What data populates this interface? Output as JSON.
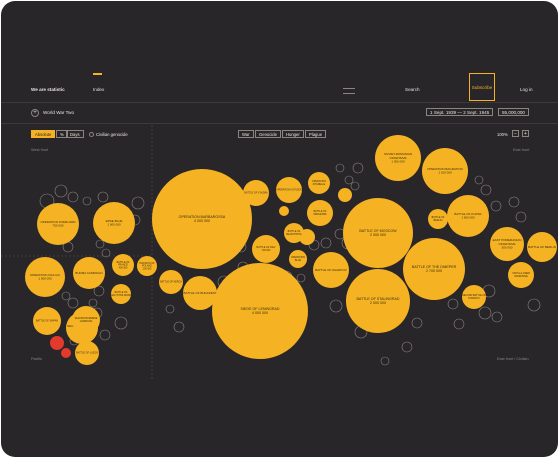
{
  "nav": {
    "brand": "We are statistic",
    "index": "Index",
    "search": "Search",
    "subscribe": "Subscribe",
    "login": "Log in"
  },
  "toolbar": {
    "ww_label": "World War Two",
    "date_range": "1 Sept. 1939 — 2 Sept. 1945",
    "total": "55,000,000"
  },
  "controls": {
    "absolute": "Absolute",
    "percent": "%",
    "days": "Days",
    "civilian": "Civilian genocide",
    "filters": [
      "War",
      "Genocide",
      "Hunger",
      "Plague"
    ],
    "zoom": "100%",
    "zoom_out": "−",
    "zoom_in": "+"
  },
  "regions": {
    "west": "West front",
    "east": "East front",
    "pacific": "Pacific",
    "east_civil": "East front / Civilian"
  },
  "colors": {
    "background": "#29262a",
    "accent": "#f5b323",
    "red": "#e23a2c",
    "muted": "#8a8580"
  },
  "bubbles": [
    {
      "label": "OPERATION BARBAROSSA",
      "value": "4 000 000",
      "color": "#f5b323"
    },
    {
      "label": "SIEGE OF LENINGRAD",
      "value": "4 000 000",
      "color": "#f5b323"
    },
    {
      "label": "BATTLE OF MOSCOW",
      "value": "2 000 000",
      "color": "#f5b323"
    },
    {
      "label": "BATTLE OF STALINGRAD",
      "value": "2 000 000",
      "color": "#f5b323"
    },
    {
      "label": "BATTLE OF THE DNIEPER",
      "value": "2 700 000",
      "color": "#f5b323"
    },
    {
      "label": "SOVIET-ROMANIAN OFFENSIVE",
      "value": "1 300 000",
      "color": "#f5b323"
    },
    {
      "label": "OPERATION BAGRATION",
      "value": "1 100 000",
      "color": "#f5b323"
    },
    {
      "label": "BATTLE OF KURSK",
      "value": "1 600 000",
      "color": "#f5b323"
    },
    {
      "label": "EAST POMERANIAN OFFENSIVE",
      "value": "500 000",
      "color": "#f5b323"
    },
    {
      "label": "BATTLE OF BERLIN",
      "value": "",
      "color": "#f5b323"
    },
    {
      "label": "OPERATION OVERLORD",
      "value": "750 000",
      "color": "#f5b323"
    },
    {
      "label": "ERSE BLUE",
      "value": "1 000 000",
      "color": "#f5b323"
    },
    {
      "label": "BATTLE OF FRANCE",
      "value": "400 000",
      "color": "#f5b323"
    },
    {
      "label": "INVASION OF POLAND",
      "value": "200 000",
      "color": "#f5b323"
    },
    {
      "label": "OPERATION KANTAKURI",
      "value": "",
      "color": "#f5b323"
    },
    {
      "label": "OPERATION ICHI-GO",
      "value": "1 000 000",
      "color": "#f5b323"
    },
    {
      "label": "BATTLE OF SAIPAN",
      "value": "",
      "color": "#f5b323"
    },
    {
      "label": "SECOND BATTLE OF SAIPAN",
      "value": "",
      "color": "#f5b323"
    },
    {
      "label": "SECOND BURMESE CAMPAIGN",
      "value": "",
      "color": "#f5b323"
    },
    {
      "label": "BURMA CAMPAIGN",
      "value": "",
      "color": "#f5b323"
    },
    {
      "label": "BATTLE OF LUZON",
      "value": "",
      "color": "#f5b323"
    },
    {
      "label": "BATTLE OF SMOLENSK",
      "value": "",
      "color": "#f5b323"
    },
    {
      "label": "BATTLE OF KIEV",
      "value": "700 000",
      "color": "#f5b323"
    },
    {
      "label": "BATTLE OF VYAZMA",
      "value": "",
      "color": "#f5b323"
    },
    {
      "label": "BATTLE OF KHARKOV",
      "value": "",
      "color": "#f5b323"
    },
    {
      "label": "BATTLE OF BUDAPEST",
      "value": "",
      "color": "#f5b323"
    },
    {
      "label": "BATTLE OF KERCH",
      "value": "",
      "color": "#f5b323"
    },
    {
      "label": "BATTLE OF THE CAUCASUS",
      "value": "",
      "color": "#f5b323"
    },
    {
      "label": "OPERATION ZITADELLE",
      "value": "",
      "color": "#f5b323"
    },
    {
      "label": "OPERATION KUTUZOV",
      "value": "",
      "color": "#f5b323"
    },
    {
      "label": "BATTLE OF SEVASTOPOL",
      "value": "",
      "color": "#f5b323"
    },
    {
      "label": "OPERATION BLUE",
      "value": "",
      "color": "#f5b323"
    },
    {
      "label": "BATTLE OF UMAN",
      "value": "",
      "color": "#f5b323"
    },
    {
      "label": "BATTLE OF BIALYSTOK-MINSK",
      "value": "",
      "color": "#f5b323"
    },
    {
      "label": "KERCH",
      "value": "",
      "color": "#f5b323"
    },
    {
      "label": "SECOND BATTLE OF KHARKOV",
      "value": "",
      "color": "#f5b323"
    },
    {
      "label": "VISTULA-ODER OFFENSIVE",
      "value": "",
      "color": "#f5b323"
    },
    {
      "label": "BATTLE OF BERLIN",
      "value": "",
      "color": "#f5b323"
    }
  ]
}
